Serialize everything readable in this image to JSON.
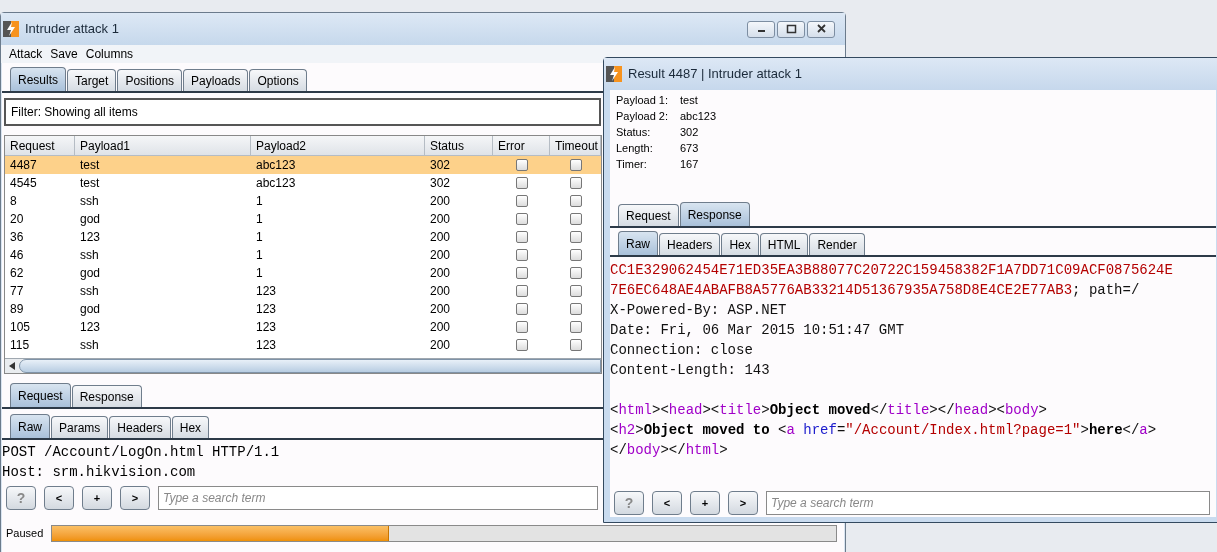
{
  "main_window": {
    "title": "Intruder attack 1",
    "menu": [
      "Attack",
      "Save",
      "Columns"
    ],
    "tabs": [
      {
        "label": "Results",
        "selected": true
      },
      {
        "label": "Target",
        "selected": false
      },
      {
        "label": "Positions",
        "selected": false
      },
      {
        "label": "Payloads",
        "selected": false
      },
      {
        "label": "Options",
        "selected": false
      }
    ],
    "filter": "Filter:  Showing all items",
    "table": {
      "columns": [
        "Request",
        "Payload1",
        "Payload2",
        "Status",
        "Error",
        "Timeout"
      ],
      "rows": [
        {
          "request": "4487",
          "payload1": "test",
          "payload2": "abc123",
          "status": "302",
          "error": false,
          "timeout": false,
          "selected": true
        },
        {
          "request": "4545",
          "payload1": "test",
          "payload2": "abc123",
          "status": "302",
          "error": false,
          "timeout": false,
          "selected": false
        },
        {
          "request": "8",
          "payload1": "ssh",
          "payload2": "1",
          "status": "200",
          "error": false,
          "timeout": false,
          "selected": false
        },
        {
          "request": "20",
          "payload1": "god",
          "payload2": "1",
          "status": "200",
          "error": false,
          "timeout": false,
          "selected": false
        },
        {
          "request": "36",
          "payload1": "123",
          "payload2": "1",
          "status": "200",
          "error": false,
          "timeout": false,
          "selected": false
        },
        {
          "request": "46",
          "payload1": "ssh",
          "payload2": "1",
          "status": "200",
          "error": false,
          "timeout": false,
          "selected": false
        },
        {
          "request": "62",
          "payload1": "god",
          "payload2": "1",
          "status": "200",
          "error": false,
          "timeout": false,
          "selected": false
        },
        {
          "request": "77",
          "payload1": "ssh",
          "payload2": "123",
          "status": "200",
          "error": false,
          "timeout": false,
          "selected": false
        },
        {
          "request": "89",
          "payload1": "god",
          "payload2": "123",
          "status": "200",
          "error": false,
          "timeout": false,
          "selected": false
        },
        {
          "request": "105",
          "payload1": "123",
          "payload2": "123",
          "status": "200",
          "error": false,
          "timeout": false,
          "selected": false
        },
        {
          "request": "115",
          "payload1": "ssh",
          "payload2": "123",
          "status": "200",
          "error": false,
          "timeout": false,
          "selected": false
        }
      ]
    },
    "message_tabs": [
      {
        "label": "Request",
        "selected": true
      },
      {
        "label": "Response",
        "selected": false
      }
    ],
    "view_tabs": [
      {
        "label": "Raw",
        "selected": true
      },
      {
        "label": "Params",
        "selected": false
      },
      {
        "label": "Headers",
        "selected": false
      },
      {
        "label": "Hex",
        "selected": false
      }
    ],
    "request_lines": [
      "POST /Account/LogOn.html HTTP/1.1",
      "Host: srm.hikvision.com"
    ],
    "search": {
      "buttons": [
        "?",
        "<",
        "+",
        ">"
      ],
      "placeholder": "Type a search term"
    },
    "progress": {
      "label": "Paused",
      "level": 0.43
    }
  },
  "result_window": {
    "title": "Result 4487 | Intruder attack 1",
    "fields": [
      {
        "label": "Payload 1:",
        "value": "test"
      },
      {
        "label": "Payload 2:",
        "value": "abc123"
      },
      {
        "label": "Status:",
        "value": "302"
      },
      {
        "label": "Length:",
        "value": "673"
      },
      {
        "label": "Timer:",
        "value": "167"
      }
    ],
    "message_tabs": [
      {
        "label": "Request",
        "selected": false
      },
      {
        "label": "Response",
        "selected": true
      }
    ],
    "view_tabs": [
      {
        "label": "Raw",
        "selected": true
      },
      {
        "label": "Headers",
        "selected": false
      },
      {
        "label": "Hex",
        "selected": false
      },
      {
        "label": "HTML",
        "selected": false
      },
      {
        "label": "Render",
        "selected": false
      }
    ],
    "response_headers": [
      [
        {
          "text": "CC1E329062454E71ED35EA3B88077C20722C159458382F1A7DD71C09ACF0875624E",
          "kind": "value"
        }
      ],
      [
        {
          "text": "7E6EC648AE4ABAFB8A5776AB33214D51367935A758D8E4CE2E77AB3",
          "kind": "value"
        },
        {
          "text": "; path=/",
          "kind": "plain"
        }
      ],
      [
        {
          "text": "X-Powered-By: ASP.NET",
          "kind": "plain"
        }
      ],
      [
        {
          "text": "Date: Fri, 06 Mar 2015 10:51:47 GMT",
          "kind": "plain"
        }
      ],
      [
        {
          "text": "Connection: close",
          "kind": "plain"
        }
      ],
      [
        {
          "text": "Content-Length: 143",
          "kind": "plain"
        }
      ]
    ],
    "response_body": [
      [
        {
          "text": "<",
          "kind": "plain"
        },
        {
          "text": "html",
          "kind": "tag"
        },
        {
          "text": "><",
          "kind": "plain"
        },
        {
          "text": "head",
          "kind": "tag"
        },
        {
          "text": "><",
          "kind": "plain"
        },
        {
          "text": "title",
          "kind": "tag"
        },
        {
          "text": ">",
          "kind": "plain"
        },
        {
          "text": "Object moved",
          "kind": "bold"
        },
        {
          "text": "</",
          "kind": "plain"
        },
        {
          "text": "title",
          "kind": "tag"
        },
        {
          "text": "></",
          "kind": "plain"
        },
        {
          "text": "head",
          "kind": "tag"
        },
        {
          "text": "><",
          "kind": "plain"
        },
        {
          "text": "body",
          "kind": "tag"
        },
        {
          "text": ">",
          "kind": "plain"
        }
      ],
      [
        {
          "text": "<",
          "kind": "plain"
        },
        {
          "text": "h2",
          "kind": "tag"
        },
        {
          "text": ">",
          "kind": "plain"
        },
        {
          "text": "Object moved to ",
          "kind": "bold"
        },
        {
          "text": "<",
          "kind": "plain"
        },
        {
          "text": "a",
          "kind": "tag"
        },
        {
          "text": " href",
          "kind": "attr"
        },
        {
          "text": "=",
          "kind": "plain"
        },
        {
          "text": "\"/Account/Index.html?page=1\"",
          "kind": "value"
        },
        {
          "text": ">",
          "kind": "plain"
        },
        {
          "text": "here",
          "kind": "bold"
        },
        {
          "text": "</",
          "kind": "plain"
        },
        {
          "text": "a",
          "kind": "tag"
        },
        {
          "text": ">",
          "kind": "plain"
        }
      ],
      [
        {
          "text": "</",
          "kind": "plain"
        },
        {
          "text": "body",
          "kind": "tag"
        },
        {
          "text": "></",
          "kind": "plain"
        },
        {
          "text": "html",
          "kind": "tag"
        },
        {
          "text": ">",
          "kind": "plain"
        }
      ]
    ],
    "search": {
      "buttons": [
        "?",
        "<",
        "+",
        ">"
      ],
      "placeholder": "Type a search term"
    }
  }
}
